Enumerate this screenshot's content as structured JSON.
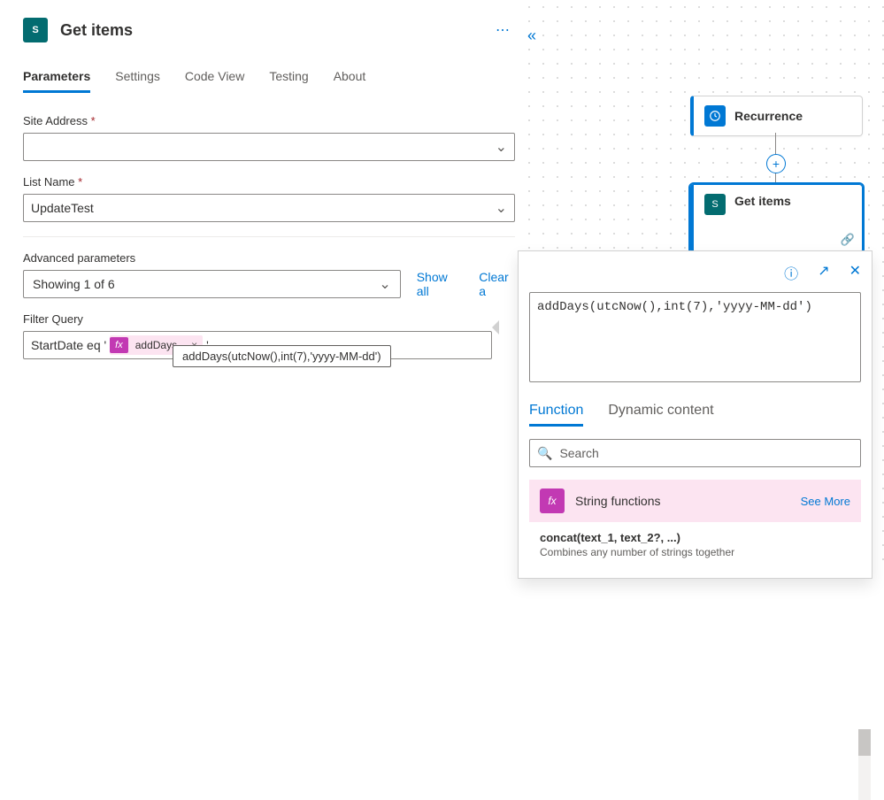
{
  "header": {
    "title": "Get items"
  },
  "tabs": [
    "Parameters",
    "Settings",
    "Code View",
    "Testing",
    "About"
  ],
  "activeTab": 0,
  "fields": {
    "siteAddress": {
      "label": "Site Address",
      "required": true,
      "value": ""
    },
    "listName": {
      "label": "List Name",
      "required": true,
      "value": "UpdateTest"
    }
  },
  "advanced": {
    "label": "Advanced parameters",
    "selectText": "Showing 1 of 6",
    "showAll": "Show all",
    "clearAll": "Clear a"
  },
  "filterQuery": {
    "label": "Filter Query",
    "prefix": "StartDate eq '",
    "tokenLabel": "addDays...",
    "suffix": "'",
    "tooltip": "addDays(utcNow(),int(7),'yyyy-MM-dd')"
  },
  "canvas": {
    "node1": "Recurrence",
    "node2": "Get items"
  },
  "expression": {
    "text": "addDays(utcNow(),int(7),'yyyy-MM-dd')",
    "tabs": [
      "Function",
      "Dynamic content"
    ],
    "activeTab": 0,
    "searchPlaceholder": "Search",
    "category": "String functions",
    "seeMore": "See More",
    "functions": [
      {
        "name": "concat(text_1, text_2?, ...)",
        "desc": "Combines any number of strings together"
      }
    ]
  }
}
